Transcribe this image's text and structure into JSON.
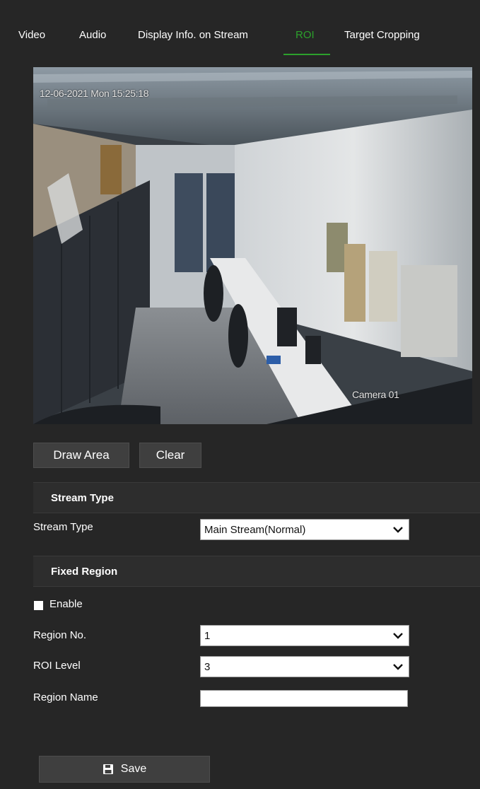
{
  "tabs": [
    {
      "label": "Video",
      "active": false
    },
    {
      "label": "Audio",
      "active": false
    },
    {
      "label": "Display Info. on Stream",
      "active": false
    },
    {
      "label": "ROI",
      "active": true
    },
    {
      "label": "Target Cropping",
      "active": false
    }
  ],
  "preview": {
    "timestamp": "12-06-2021 Mon 15:25:18",
    "camera_name": "Camera 01"
  },
  "toolbar": {
    "draw_area_label": "Draw Area",
    "clear_label": "Clear"
  },
  "stream_section": {
    "header": "Stream Type",
    "field_label": "Stream Type",
    "value": "Main Stream(Normal)"
  },
  "fixed_region": {
    "header": "Fixed Region",
    "enable_label": "Enable",
    "enable_checked": false,
    "region_no_label": "Region No.",
    "region_no_value": "1",
    "roi_level_label": "ROI Level",
    "roi_level_value": "3",
    "region_name_label": "Region Name",
    "region_name_value": ""
  },
  "save": {
    "label": "Save",
    "icon": "floppy-disk-icon"
  },
  "colors": {
    "background": "#262626",
    "accent": "#2ca02c",
    "button": "#3f3f3f"
  }
}
